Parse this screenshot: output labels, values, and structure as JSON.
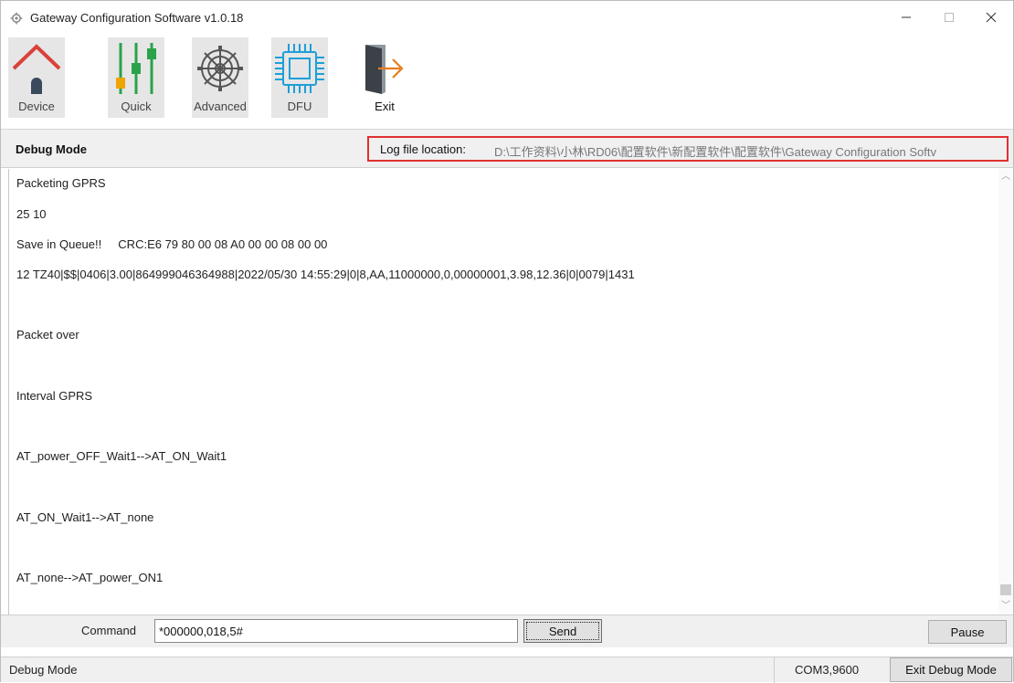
{
  "window": {
    "title": "Gateway Configuration Software v1.0.18",
    "minimize": "—",
    "maximize": "☐",
    "close": "✕"
  },
  "toolbar": {
    "items": [
      {
        "label": "Device",
        "icon": "house-icon"
      },
      {
        "label": "Quick",
        "icon": "sliders-icon"
      },
      {
        "label": "Advanced",
        "icon": "gear-icon"
      },
      {
        "label": "DFU",
        "icon": "chip-icon"
      },
      {
        "label": "Exit",
        "icon": "exit-door-icon"
      }
    ]
  },
  "header": {
    "mode_title": "Debug Mode",
    "log_label": "Log file location:",
    "log_path": "D:\\工作资料\\小林\\RD06\\配置软件\\新配置软件\\配置软件\\Gateway Configuration Softv"
  },
  "log": {
    "lines": [
      "Packeting GPRS",
      "25 10",
      "Save in Queue!!     CRC:E6 79 80 00 08 A0 00 00 08 00 00",
      "12 TZ40|$$|0406|3.00|864999046364988|2022/05/30 14:55:29|0|8,AA,11000000,0,00000001,3.98,12.36|0|0079|1431",
      "Packet over",
      "Interval GPRS",
      "AT_power_OFF_Wait1-->AT_ON_Wait1",
      "AT_ON_Wait1-->AT_none",
      "AT_none-->AT_power_ON1"
    ]
  },
  "command": {
    "label": "Command",
    "value": "*000000,018,5#",
    "send_label": "Send",
    "pause_label": "Pause"
  },
  "status": {
    "mode": "Debug Mode",
    "port": "COM3,9600",
    "exit_debug_label": "Exit Debug Mode"
  },
  "colors": {
    "highlight_border": "#e03030",
    "house_roof": "#d9413a",
    "slider_green": "#2aa24a",
    "slider_orange": "#f0a400",
    "chip_blue": "#1e9fd8",
    "exit_arrow": "#e87d1e"
  }
}
